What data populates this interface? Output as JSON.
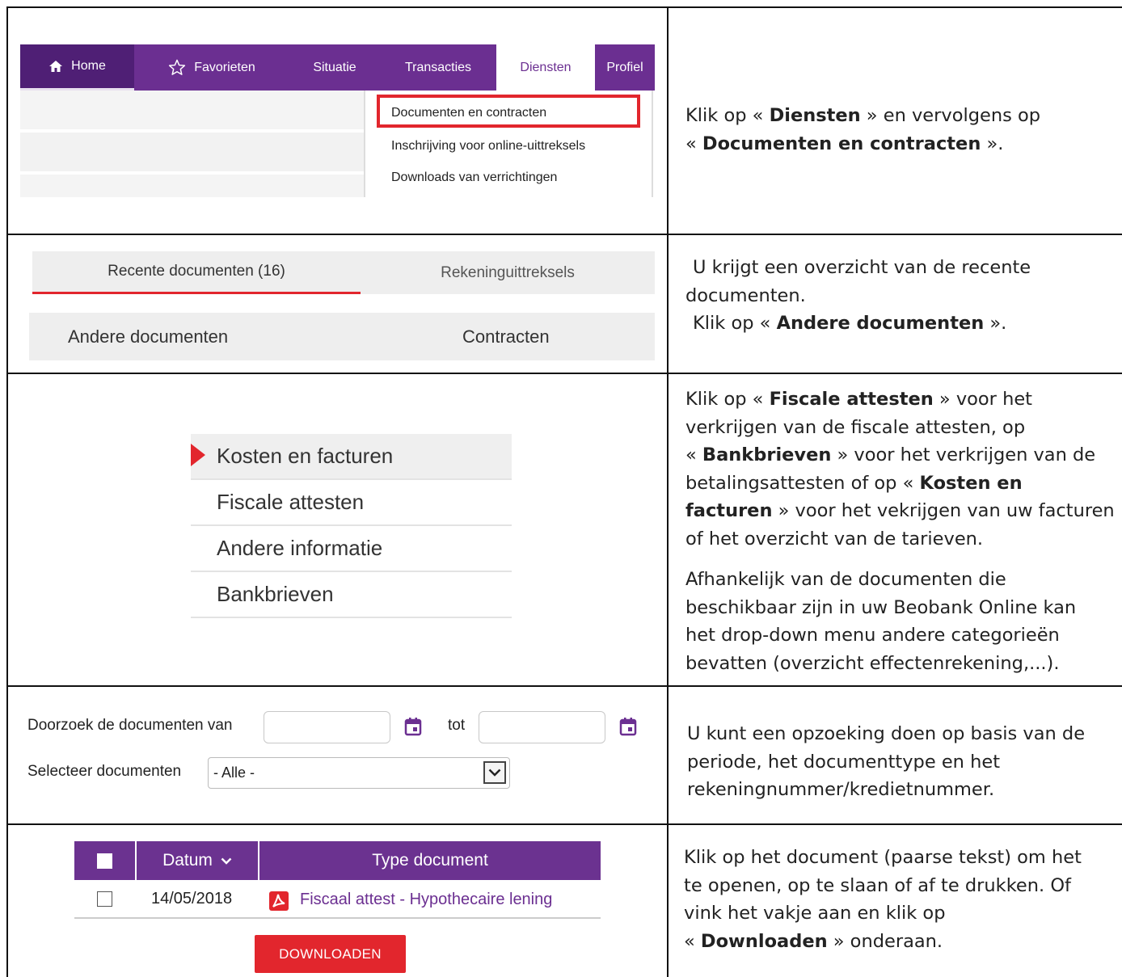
{
  "nav": {
    "items": [
      "Home",
      "Favorieten",
      "Situatie",
      "Transacties",
      "Diensten",
      "Profiel"
    ],
    "active": "Diensten",
    "submenu": [
      "Documenten en contracten",
      "Inschrijving voor online-uittreksels",
      "Downloads van verrichtingen"
    ]
  },
  "step1": {
    "parts": [
      "Klik op « ",
      "Diensten",
      " » en vervolgens op",
      "« ",
      "Documenten en contracten",
      " »."
    ]
  },
  "tabs": {
    "recent": "Recente documenten (16)",
    "statements": "Rekeninguittreksels",
    "other": "Andere documenten",
    "contracts": "Contracten"
  },
  "step2": {
    "line1": "U krijgt een overzicht van de recente",
    "line2": "documenten.",
    "line3a": "Klik op « ",
    "line3b": "Andere documenten",
    "line3c": " »."
  },
  "categories": [
    "Kosten en facturen",
    "Fiscale attesten",
    "Andere informatie",
    "Bankbrieven"
  ],
  "step3": {
    "p1": {
      "l1a": "Klik op « ",
      "l1b": "Fiscale attesten",
      "l1c": " » voor het",
      "l2": "verkrijgen van de fiscale attesten, op",
      "l3a": "« ",
      "l3b": "Bankbrieven",
      "l3c": " »  voor het verkrijgen van de",
      "l4a": "betalingsattesten of op  « ",
      "l4b": "Kosten en",
      "l5a": "facturen",
      "l5b": " » voor het vekrijgen van uw facturen",
      "l6": "of het overzicht van de tarieven."
    },
    "p2": {
      "l1": "Afhankelijk van de documenten die",
      "l2": "beschikbaar zijn in uw Beobank Online kan",
      "l3": "het drop-down menu andere categorieën",
      "l4": "bevatten (overzicht effectenrekening,...)."
    }
  },
  "search": {
    "from_label": "Doorzoek de documenten van",
    "to_label": "tot",
    "select_label": "Selecteer documenten",
    "select_value": "- Alle -"
  },
  "step4": {
    "l1": "U kunt een opzoeking doen op basis van de",
    "l2": "periode, het documenttype en het",
    "l3": "rekeningnummer/kredietnummer."
  },
  "table": {
    "col_date": "Datum",
    "col_type": "Type document",
    "row_date": "14/05/2018",
    "row_doc": "Fiscaal attest - Hypothecaire lening",
    "download": "DOWNLOADEN"
  },
  "step5": {
    "l1": "Klik op het document (paarse tekst) om het",
    "l2": "te openen, op te slaan of af te drukken. Of",
    "l3": "vink het vakje aan en klik op",
    "l4a": "« ",
    "l4b": "Downloaden",
    "l4c": " » onderaan."
  },
  "colors": {
    "purple": "#6b2f91",
    "red": "#e2262d"
  }
}
